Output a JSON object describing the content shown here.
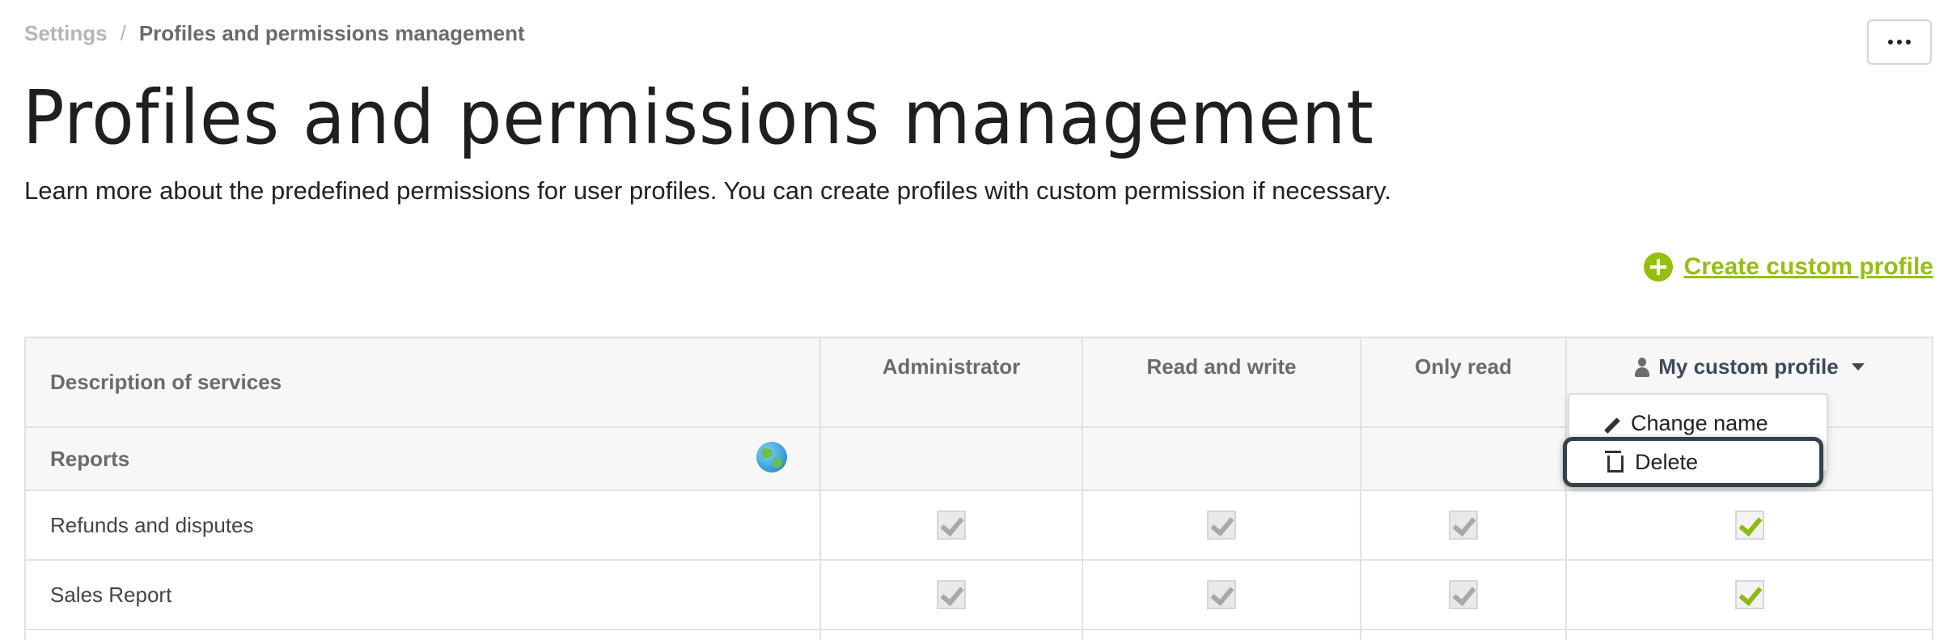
{
  "breadcrumb": {
    "root": "Settings",
    "separator": "/",
    "current": "Profiles and permissions management"
  },
  "header": {
    "title": "Profiles and permissions management",
    "subtitle": "Learn more about the predefined permissions for user profiles. You can create profiles with custom permission if necessary.",
    "more_icon": "ellipsis-icon"
  },
  "actions": {
    "create_profile_label": "Create custom profile",
    "create_icon": "plus-circle-icon",
    "accent_color": "#95bf0f"
  },
  "table": {
    "headers": {
      "description": "Description of services",
      "admin": "Administrator",
      "read_write": "Read and write",
      "read_only": "Only read",
      "custom": "My custom profile"
    },
    "section": {
      "label": "Reports",
      "icon": "globe-icon"
    },
    "rows": [
      {
        "label": "Refunds and disputes"
      },
      {
        "label": "Sales Report"
      }
    ]
  },
  "dropdown": {
    "change_name": "Change name",
    "delete": "Delete"
  }
}
